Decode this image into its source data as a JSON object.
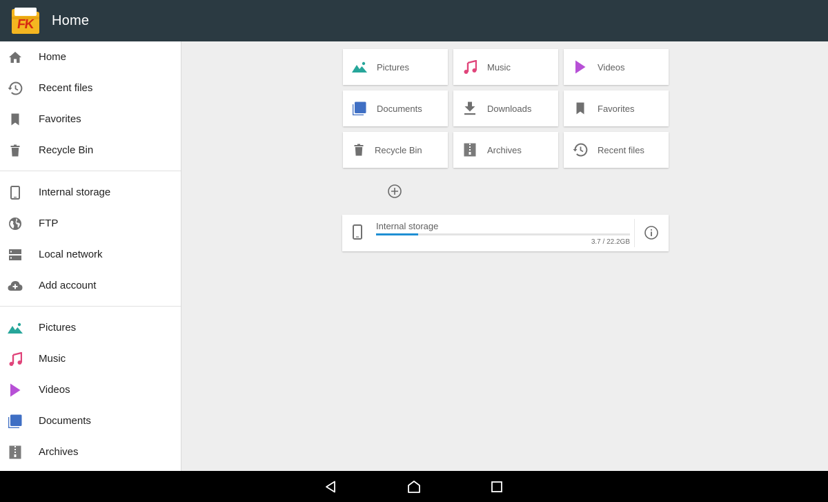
{
  "app": {
    "title": "Home",
    "logo_text": "FK",
    "colors": {
      "appbar": "#2b3a42",
      "logo_folder": "#f4b621",
      "logo_letters": "#d62b12",
      "accent": "#1f8fd3"
    }
  },
  "sidebar": {
    "groups": [
      [
        {
          "label": "Home",
          "icon": "home-icon"
        },
        {
          "label": "Recent files",
          "icon": "history-icon"
        },
        {
          "label": "Favorites",
          "icon": "bookmark-icon"
        },
        {
          "label": "Recycle Bin",
          "icon": "trash-icon"
        }
      ],
      [
        {
          "label": "Internal storage",
          "icon": "phone-icon"
        },
        {
          "label": "FTP",
          "icon": "globe-icon"
        },
        {
          "label": "Local network",
          "icon": "server-icon"
        },
        {
          "label": "Add account",
          "icon": "cloud-add-icon"
        }
      ],
      [
        {
          "label": "Pictures",
          "icon": "pictures-icon"
        },
        {
          "label": "Music",
          "icon": "music-icon"
        },
        {
          "label": "Videos",
          "icon": "videos-icon"
        },
        {
          "label": "Documents",
          "icon": "documents-icon"
        },
        {
          "label": "Archives",
          "icon": "archives-icon"
        }
      ]
    ]
  },
  "main": {
    "tiles": [
      {
        "label": "Pictures",
        "icon": "pictures-icon"
      },
      {
        "label": "Music",
        "icon": "music-icon"
      },
      {
        "label": "Videos",
        "icon": "videos-icon"
      },
      {
        "label": "Documents",
        "icon": "documents-icon"
      },
      {
        "label": "Downloads",
        "icon": "download-icon"
      },
      {
        "label": "Favorites",
        "icon": "bookmark-icon"
      },
      {
        "label": "Recycle Bin",
        "icon": "trash-icon"
      },
      {
        "label": "Archives",
        "icon": "archives-icon"
      },
      {
        "label": "Recent files",
        "icon": "history-icon"
      }
    ],
    "add_icon": "add-circle-icon",
    "storage": {
      "name": "Internal storage",
      "size_text": "3.7 / 22.2GB",
      "used_fraction": 0.1667,
      "icon": "phone-icon",
      "info_icon": "info-icon"
    }
  },
  "navbar": {
    "buttons": [
      {
        "icon": "back-icon"
      },
      {
        "icon": "home-nav-icon"
      },
      {
        "icon": "recents-icon"
      }
    ]
  }
}
